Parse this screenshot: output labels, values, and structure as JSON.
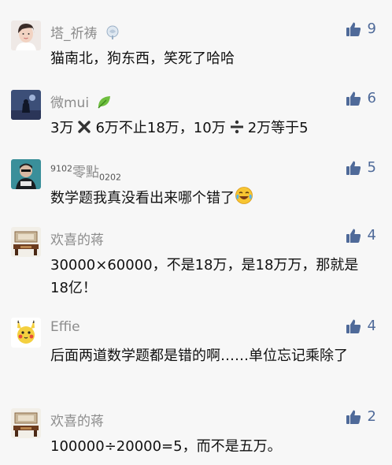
{
  "comments": [
    {
      "name": "塔_祈祷",
      "likes": "9",
      "text": "猫南北，狗东西，笑死了哈哈"
    },
    {
      "name": "微mui",
      "likes": "6",
      "text_parts": [
        "3万",
        "6万不止18万，10万",
        "2万等于5"
      ]
    },
    {
      "name_prefix": "9102",
      "name_main": "零點",
      "name_suffix": "0202",
      "likes": "5",
      "text": "数学题我真没看出来哪个错了"
    },
    {
      "name": "欢喜的蒋",
      "likes": "4",
      "text": "30000×60000，不是18万，是18万万，那就是18亿！"
    },
    {
      "name": "Effie",
      "likes": "4",
      "text": "后面两道数学题都是错的啊……单位忘记乘除了"
    },
    {
      "name": "欢喜的蒋",
      "likes": "2",
      "text": "100000÷20000=5，而不是五万。"
    }
  ],
  "icons": {
    "like": "thumbs-up-icon",
    "name_badge_1": "hair-clip-icon",
    "name_badge_2": "leaf-icon",
    "multiply": "multiply-icon",
    "divide": "divide-icon",
    "crying_laughing": "tears-of-joy-emoji"
  },
  "colors": {
    "like_accent": "#4f6a99",
    "name": "#8c8c8c",
    "background": "#f7f7f7"
  }
}
